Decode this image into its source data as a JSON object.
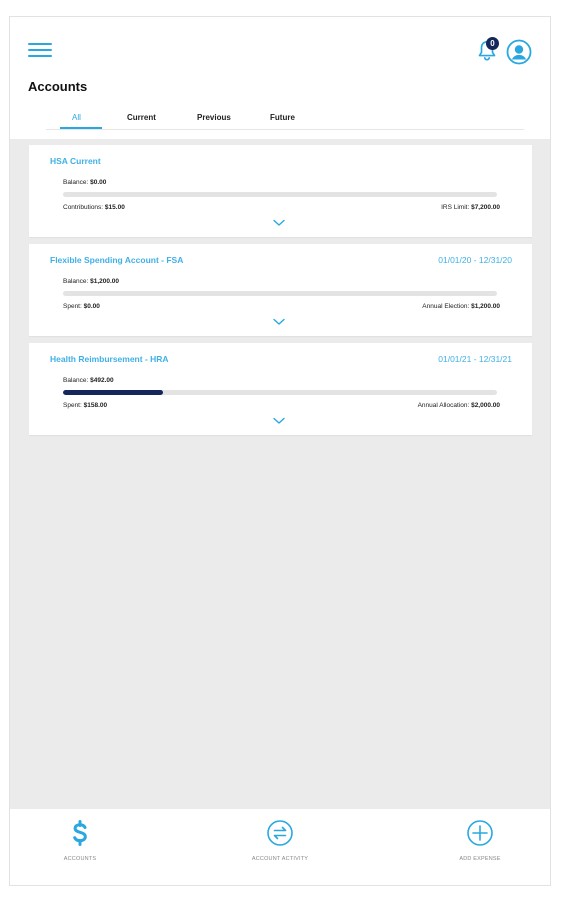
{
  "header": {
    "notification_count": "0",
    "page_title": "Accounts"
  },
  "tabs": [
    "All",
    "Current",
    "Previous",
    "Future"
  ],
  "accounts": [
    {
      "name": "HSA Current",
      "dates": "",
      "balance_label": "Balance:",
      "balance_value": "$0.00",
      "progress_fraction": 0.0,
      "left_label": "Contributions:",
      "left_value": "$15.00",
      "right_label": "IRS Limit:",
      "right_value": "$7,200.00"
    },
    {
      "name": "Flexible Spending Account - FSA",
      "dates": "01/01/20 - 12/31/20",
      "balance_label": "Balance:",
      "balance_value": "$1,200.00",
      "progress_fraction": 0.0,
      "left_label": "Spent:",
      "left_value": "$0.00",
      "right_label": "Annual Election:",
      "right_value": "$1,200.00"
    },
    {
      "name": "Health Reimbursement - HRA",
      "dates": "01/01/21 - 12/31/21",
      "balance_label": "Balance:",
      "balance_value": "$492.00",
      "progress_fraction": 0.23,
      "left_label": "Spent:",
      "left_value": "$158.00",
      "right_label": "Annual Allocation:",
      "right_value": "$2,000.00"
    }
  ],
  "bottom_nav": [
    {
      "label": "ACCOUNTS",
      "icon": "dollar-icon"
    },
    {
      "label": "ACCOUNT ACTIVITY",
      "icon": "exchange-icon"
    },
    {
      "label": "ADD EXPENSE",
      "icon": "plus-circle-icon"
    }
  ],
  "colors": {
    "accent": "#29a8e0",
    "title_link": "#3fb0e6",
    "progress_fill": "#14265a",
    "progress_track": "#e3e3e3",
    "background": "#ebebeb"
  }
}
